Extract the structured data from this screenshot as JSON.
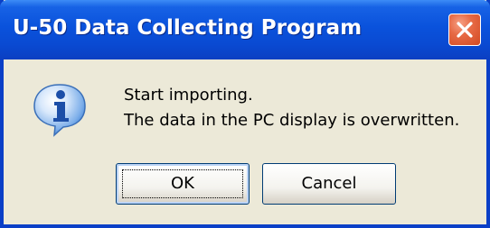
{
  "dialog": {
    "title": "U-50 Data Collecting Program",
    "message_lines": [
      "Start importing.",
      "The data in the PC display is overwritten."
    ],
    "buttons": {
      "ok_label": "OK",
      "cancel_label": "Cancel"
    }
  },
  "icons": {
    "info": "info-icon",
    "close": "close-icon"
  },
  "colors": {
    "titlebar": "#0a52dc",
    "dialog_background": "#ece9d8",
    "close_button": "#d24a23",
    "info_icon": "#2f78d4"
  }
}
